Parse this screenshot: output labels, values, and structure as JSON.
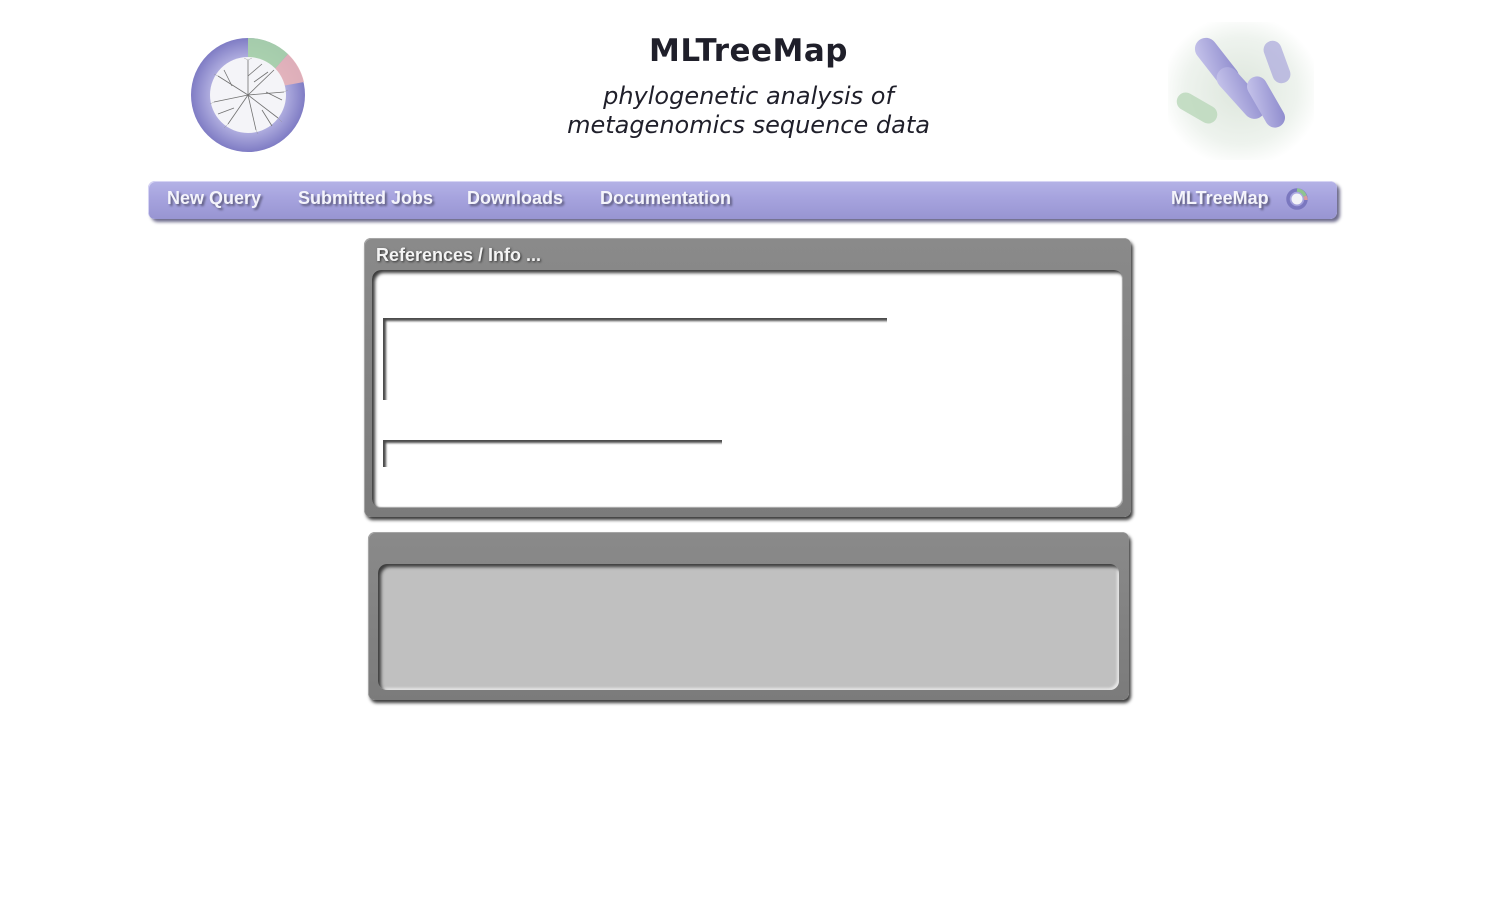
{
  "header": {
    "title": "MLTreeMap",
    "subtitle_line1": "phylogenetic analysis of",
    "subtitle_line2": "metagenomics sequence data",
    "left_logo": "tree-of-life-logo",
    "right_logo": "bacteria-image"
  },
  "nav": {
    "items": [
      {
        "label": "New Query"
      },
      {
        "label": "Submitted Jobs"
      },
      {
        "label": "Downloads"
      },
      {
        "label": "Documentation"
      }
    ],
    "brand_label": "MLTreeMap",
    "brand_icon": "circular-tree-icon",
    "bar_color": "#a6a3de"
  },
  "panels": {
    "references": {
      "title": "References / Info ..."
    },
    "second": {
      "title": ""
    }
  },
  "colors": {
    "panel_frame": "#7f7f7f",
    "panel_inner_gray": "#c0c0c0"
  }
}
